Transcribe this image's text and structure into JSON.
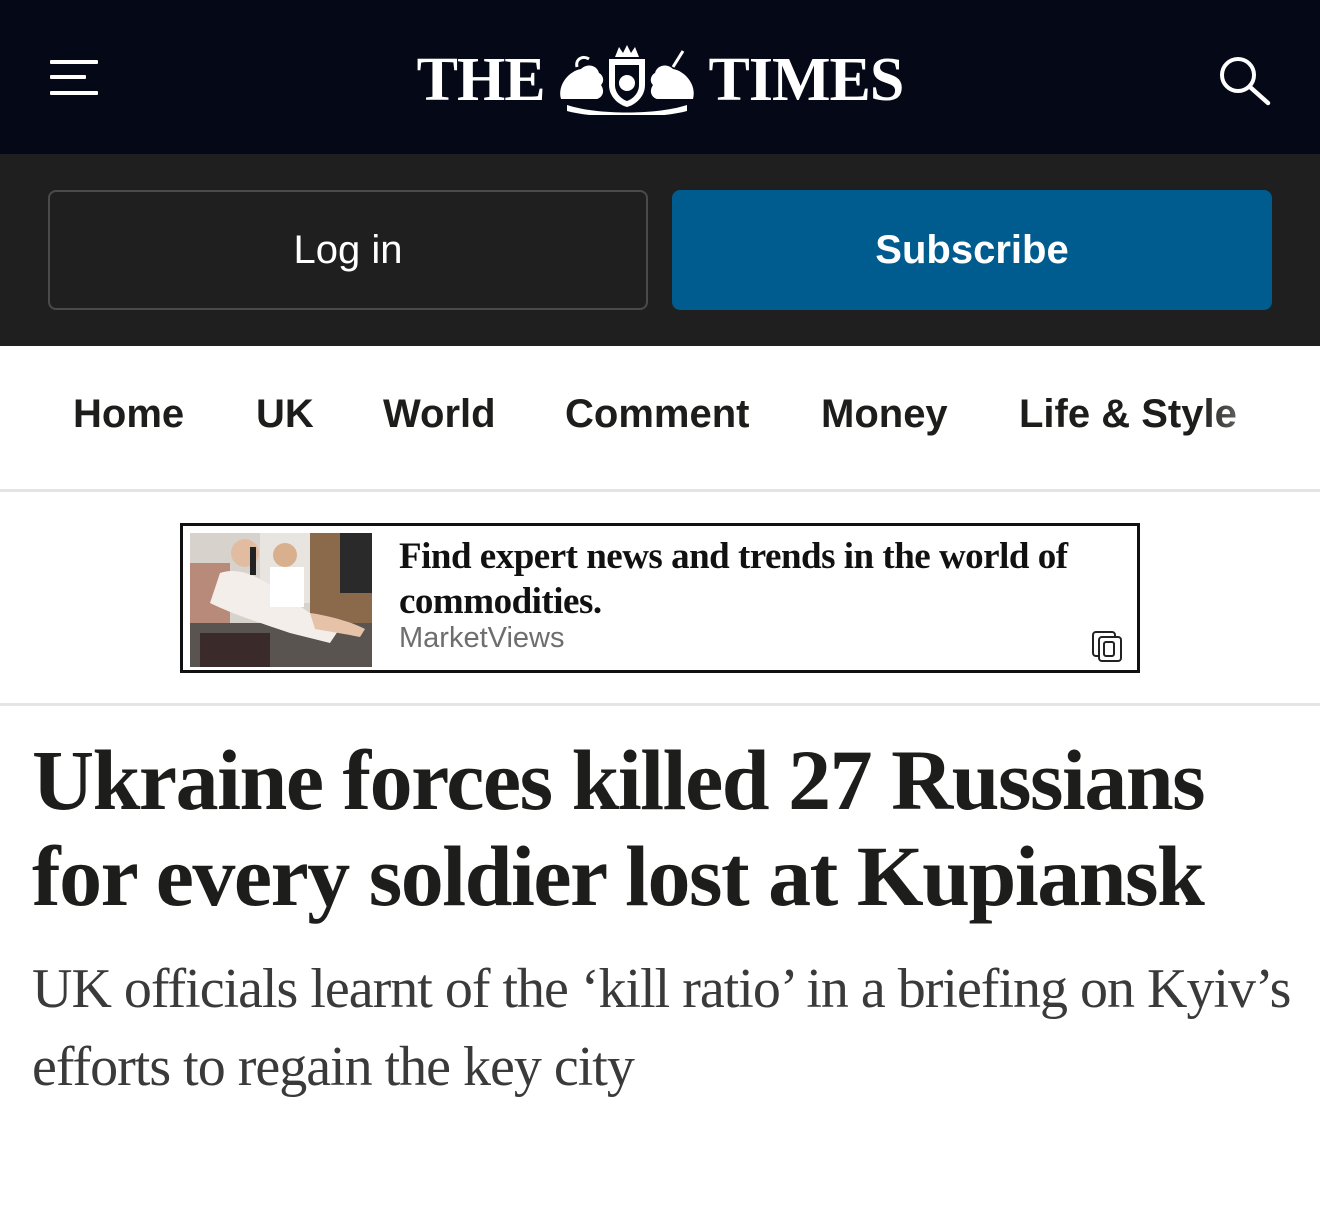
{
  "header": {
    "masthead_left": "THE",
    "masthead_right": "TIMES",
    "menu_icon": "hamburger-menu-icon",
    "search_icon": "search-icon",
    "crest_icon": "royal-crest-icon"
  },
  "auth": {
    "login_label": "Log in",
    "subscribe_label": "Subscribe"
  },
  "nav": {
    "items": [
      "Home",
      "UK",
      "World",
      "Comment",
      "Money",
      "Life & Style"
    ]
  },
  "ad": {
    "headline": "Find expert news and trends in the world of commodities.",
    "advertiser": "MarketViews",
    "adchoices_icon": "ad-choices-icon"
  },
  "article": {
    "headline": "Ukraine forces killed 27 Russians for every soldier lost at Kupiansk",
    "standfirst": "UK officials learnt of the ‘kill ratio’ in a briefing on Kyiv’s efforts to regain the key city"
  },
  "colors": {
    "topbar": "#050816",
    "authbar": "#1f1f1f",
    "subscribe": "#005b8e",
    "text": "#1d1d1b"
  }
}
